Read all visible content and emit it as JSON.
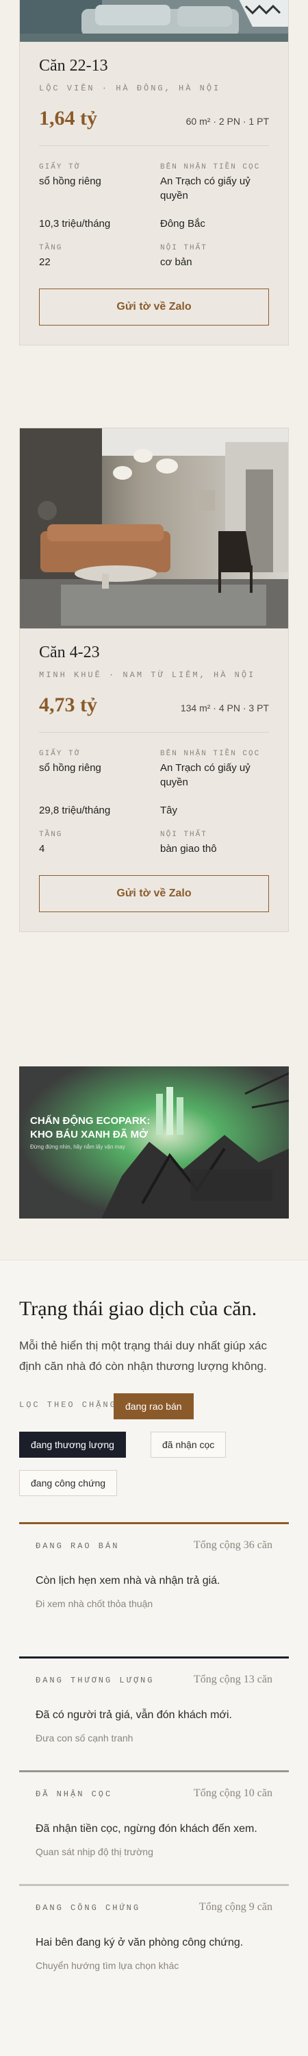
{
  "listings": [
    {
      "title": "Căn 22-13",
      "location": "LỘC VIÊN · HÀ ĐÔNG, HÀ NỘI",
      "price": "1,64 tỷ",
      "specs": "60 m² · 2 PN · 1 PT",
      "paperwork_label": "GIẤY TỜ",
      "paperwork": "sổ hồng riêng",
      "deposit_label": "BÊN NHẬN TIỀN CỌC",
      "deposit": "An Trạch có giấy uỷ quyền",
      "price_per_month": "10,3 triệu/tháng",
      "direction": "Đông Bắc",
      "floor_label": "TẦNG",
      "floor": "22",
      "interior_label": "NỘI THẤT",
      "interior": "cơ bản",
      "cta": "Gửi tờ về Zalo"
    },
    {
      "title": "Căn 4-23",
      "location": "MINH KHUÊ · NAM TỪ LIÊM, HÀ NỘI",
      "price": "4,73 tỷ",
      "specs": "134 m² · 4 PN · 3 PT",
      "paperwork_label": "GIẤY TỜ",
      "paperwork": "sổ hồng riêng",
      "deposit_label": "BÊN NHẬN TIỀN CỌC",
      "deposit": "An Trạch có giấy uỷ quyền",
      "price_per_month": "29,8 triệu/tháng",
      "direction": "Tây",
      "floor_label": "TẦNG",
      "floor": "4",
      "interior_label": "NỘI THẤT",
      "interior": "bàn giao thô",
      "cta": "Gửi tờ về Zalo"
    }
  ],
  "banner": {
    "headline_1": "CHẤN ĐỘNG ECOPARK:",
    "headline_2": "KHO BÁU XANH ĐÃ MỞ",
    "tagline": "Đừng đứng nhìn, hãy nắm lấy vận may"
  },
  "section": {
    "title": "Trạng thái giao dịch của căn.",
    "description": "Mỗi thẻ hiển thị một trạng thái duy nhất giúp xác định căn nhà đó còn nhận thương lượng không.",
    "filter_label": "LỌC THEO CHẶNG",
    "chips": [
      "đang rao bán",
      "đang thương lượng",
      "đã nhận cọc",
      "đang công chứng"
    ]
  },
  "statuses": [
    {
      "name": "ĐANG RAO BÁN",
      "total": "Tổng cộng 36 căn",
      "text": "Còn lịch hẹn xem nhà và nhận trả giá.",
      "sub": "Đi xem nhà chốt thỏa thuận",
      "color": "#8b5a2b"
    },
    {
      "name": "ĐANG THƯƠNG LƯỢNG",
      "total": "Tổng cộng 13 căn",
      "text": "Đã có người trả giá, vẫn đón khách mới.",
      "sub": "Đưa con số cạnh tranh",
      "color": "#1b1f2a"
    },
    {
      "name": "ĐÃ NHẬN CỌC",
      "total": "Tổng cộng 10 căn",
      "text": "Đã nhận tiền cọc, ngừng đón khách đến xem.",
      "sub": "Quan sát nhịp độ thị trường",
      "color": "#9a968e"
    },
    {
      "name": "ĐANG CÔNG CHỨNG",
      "total": "Tổng cộng 9 căn",
      "text": "Hai bên đang ký ở văn phòng công chứng.",
      "sub": "Chuyển hướng tìm lựa chọn khác",
      "color": "#c9c4bb"
    }
  ]
}
